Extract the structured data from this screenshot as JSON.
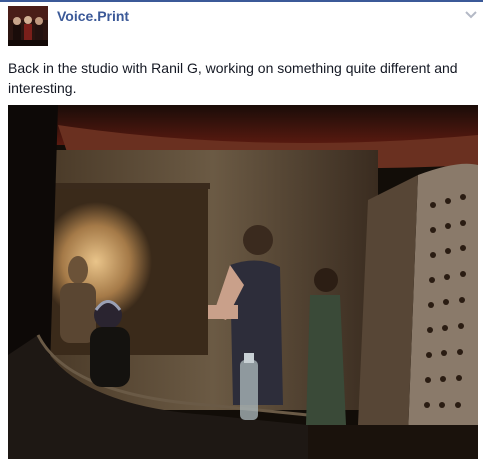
{
  "post": {
    "page_name": "Voice.Print",
    "text": "Back in the studio with Ranil G, working on something quite different and interesting.",
    "menu_icon": "chevron-down-icon",
    "photo_icon": "studio-photo"
  },
  "colors": {
    "link": "#3b5998",
    "text": "#141823",
    "top_border": "#3b5998"
  }
}
